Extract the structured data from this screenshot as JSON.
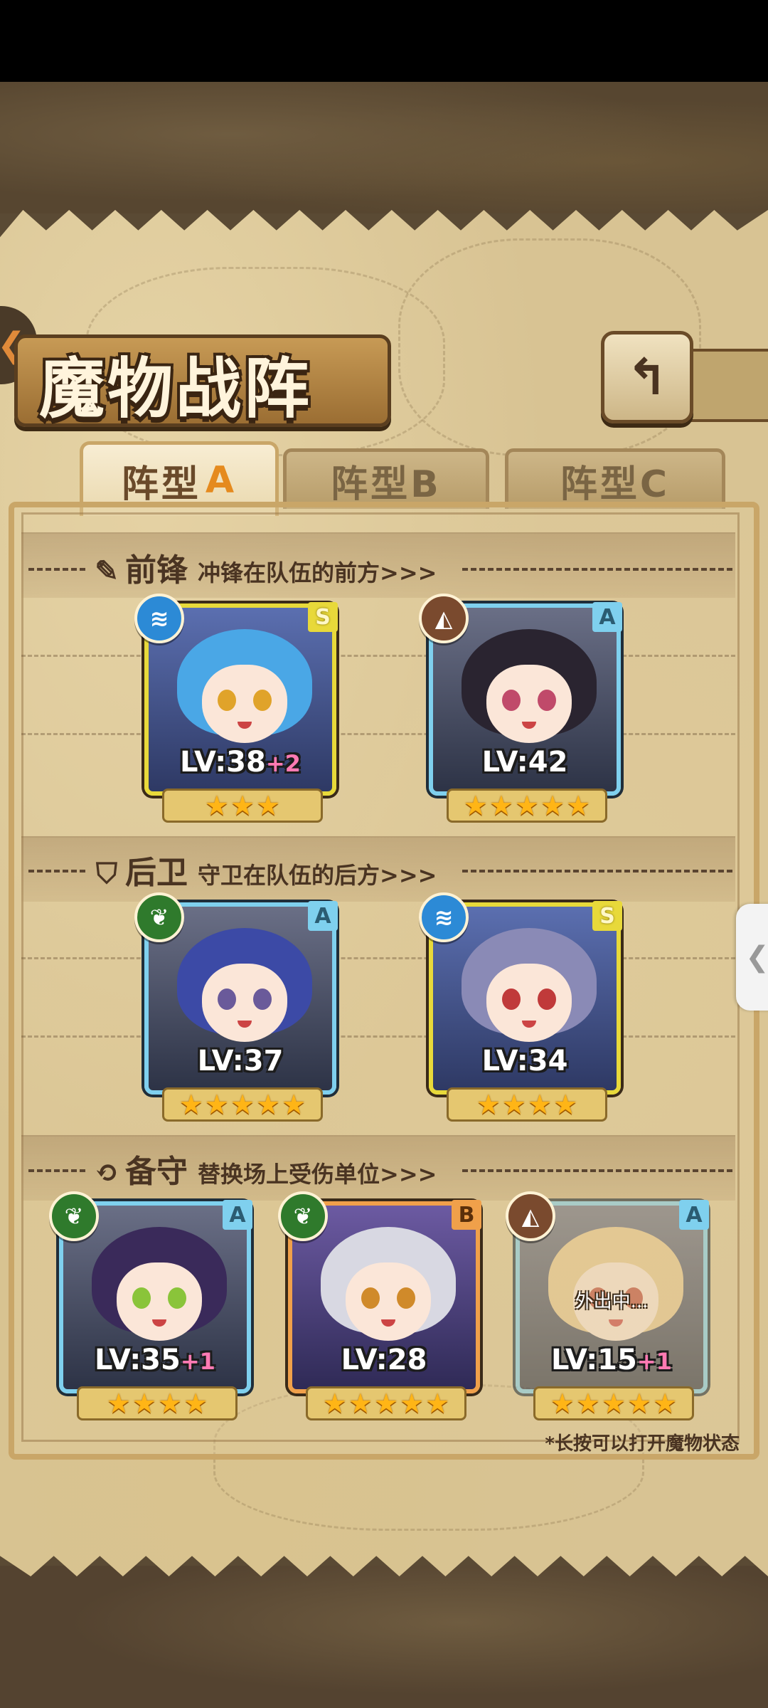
{
  "header": {
    "title": "魔物战阵",
    "back_side_icon": "chevron-left-icon",
    "return_icon": "return-arrow-icon"
  },
  "tabs": [
    {
      "label": "阵型",
      "suffix": "A",
      "active": true
    },
    {
      "label": "阵型B",
      "active": false
    },
    {
      "label": "阵型C",
      "active": false
    }
  ],
  "sections": {
    "front": {
      "title": "前锋",
      "subtitle": "冲锋在队伍的前方>>>",
      "icon": "sword-icon"
    },
    "rear": {
      "title": "后卫",
      "subtitle": "守卫在队伍的后方>>>",
      "icon": "shield-icon"
    },
    "reserve": {
      "title": "备守",
      "subtitle": "替换场上受伤单位>>>",
      "icon": "swap-icon"
    }
  },
  "monsters": {
    "front": [
      {
        "rank": "S",
        "element": "water",
        "lv": "LV:38",
        "bonus": "+2",
        "stars": 3,
        "hair": "#4aa7e6",
        "eyes": "#e0a32a"
      },
      {
        "rank": "A",
        "element": "earth",
        "lv": "LV:42",
        "bonus": "",
        "stars": 5,
        "hair": "#2a2430",
        "eyes": "#c04a6a"
      }
    ],
    "rear": [
      {
        "rank": "A",
        "element": "wood",
        "lv": "LV:37",
        "bonus": "",
        "stars": 5,
        "hair": "#3c4aa6",
        "eyes": "#6a5a9a"
      },
      {
        "rank": "S",
        "element": "water",
        "lv": "LV:34",
        "bonus": "",
        "stars": 4,
        "hair": "#8a8ab6",
        "eyes": "#c03a3a"
      }
    ],
    "reserve": [
      {
        "rank": "A",
        "element": "wood",
        "lv": "LV:35",
        "bonus": "+1",
        "stars": 4,
        "hair": "#3a2a5a",
        "eyes": "#8ac43a"
      },
      {
        "rank": "B",
        "element": "wood",
        "lv": "LV:28",
        "bonus": "",
        "stars": 5,
        "hair": "#d8d8e2",
        "eyes": "#d08a2a"
      },
      {
        "rank": "A",
        "element": "earth",
        "lv": "LV:15",
        "bonus": "+1",
        "stars": 5,
        "hair": "#e8c890",
        "eyes": "#c04a3a",
        "status": "外出中..."
      }
    ]
  },
  "hint": "*长按可以打开魔物状态"
}
